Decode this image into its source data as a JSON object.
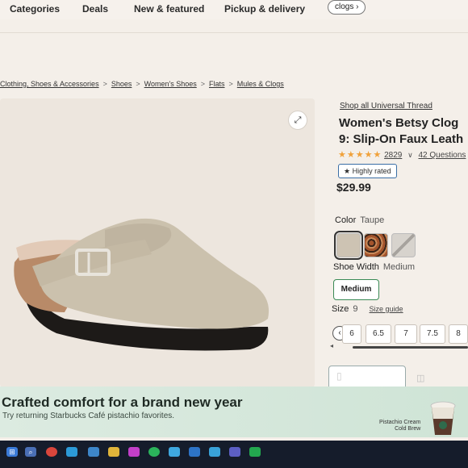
{
  "nav": {
    "items": [
      "Categories",
      "Deals",
      "New & featured",
      "Pickup & delivery"
    ],
    "search_chip": "clogs",
    "search_chip_icon": "chevron-right-icon"
  },
  "breadcrumb": [
    "Clothing, Shoes & Accessories",
    "Shoes",
    "Women's Shoes",
    "Flats",
    "Mules & Clogs"
  ],
  "product": {
    "shop_link": "Shop all Universal Thread",
    "title_line1": "Women's Betsy Clog",
    "title_line2": "9: Slip-On Faux Leath",
    "stars_icon": "★★★★★",
    "rating_count": "2829",
    "questions": "42 Questions",
    "badge": "Highly rated",
    "badge_icon": "star-icon",
    "price": "$29.99",
    "color_label": "Color",
    "color_value": "Taupe",
    "swatches": [
      "taupe",
      "leopard",
      "grey"
    ],
    "swatch_colors": [
      "#cdc3b3",
      "#a4542c",
      "#cfcac3"
    ],
    "width_label": "Shoe Width",
    "width_value": "Medium",
    "width_option": "Medium",
    "size_label": "Size",
    "size_value": "9",
    "size_guide": "Size guide",
    "sizes": [
      "6",
      "6.5",
      "7",
      "7.5",
      "8"
    ]
  },
  "promo": {
    "title": "Crafted comfort for a brand new year",
    "subtitle": "Try returning Starbucks Café pistachio favorites.",
    "caption_line1": "Pistachio Cream",
    "caption_line2": "Cold Brew"
  },
  "taskbar": {
    "icons": [
      "start-icon",
      "search-icon",
      "chrome-icon",
      "edge-icon",
      "store-icon",
      "files-icon",
      "media-icon",
      "spotify-icon",
      "app-icon",
      "mail-icon",
      "photos-icon",
      "teams-icon",
      "apps-icon"
    ]
  }
}
